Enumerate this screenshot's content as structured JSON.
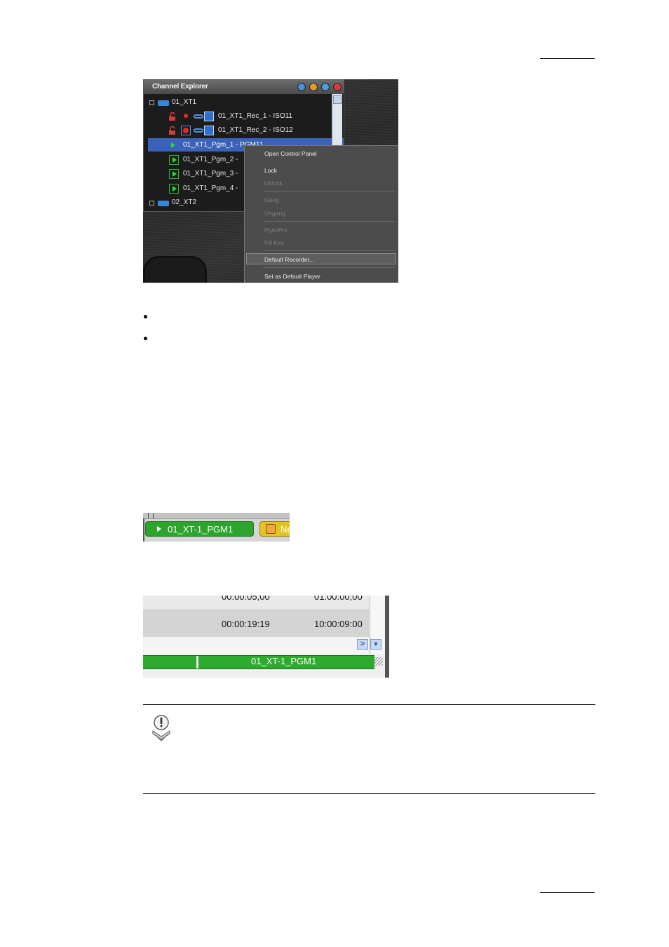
{
  "channel_explorer": {
    "title": "Channel Explorer",
    "tree": [
      {
        "label": "01_XT1",
        "kind": "server"
      },
      {
        "label": "01_XT1_Rec_1 - ISO11",
        "kind": "recorder"
      },
      {
        "label": "01_XT1_Rec_2 - ISO12",
        "kind": "recorder"
      },
      {
        "label": "01_XT1_Pgm_1 - PGM11",
        "kind": "player",
        "selected": true
      },
      {
        "label": "01_XT1_Pgm_2 -",
        "kind": "player"
      },
      {
        "label": "01_XT1_Pgm_3 -",
        "kind": "player"
      },
      {
        "label": "01_XT1_Pgm_4 -",
        "kind": "player"
      },
      {
        "label": "02_XT2",
        "kind": "server"
      }
    ],
    "context_menu": [
      {
        "label": "Open Control Panel",
        "enabled": true
      },
      {
        "label": "Lock",
        "enabled": true
      },
      {
        "label": "Unlock",
        "enabled": false
      },
      {
        "label": "Gang",
        "enabled": false
      },
      {
        "label": "Ungang",
        "enabled": false
      },
      {
        "label": "Pgm/Prv",
        "enabled": false
      },
      {
        "label": "Fill Key",
        "enabled": false
      },
      {
        "label": "Default Recorder...",
        "enabled": true,
        "highlighted": true
      },
      {
        "label": "Set as Default Player",
        "enabled": true
      }
    ]
  },
  "player_tab": {
    "channel_label": "01_XT-1_PGM1",
    "next_label": "Ne"
  },
  "timeline_list": {
    "row1": {
      "duration": "00:00:05;00",
      "tc_in": "01:00:00;00"
    },
    "row2": {
      "duration": "00:00:19:19",
      "tc_in": "10:00:09:00"
    },
    "player_label": "01_XT-1_PGM1"
  },
  "colors": {
    "selection": "#3a62b8",
    "player_green": "#2ba52b",
    "next_yellow": "#e3c322"
  }
}
